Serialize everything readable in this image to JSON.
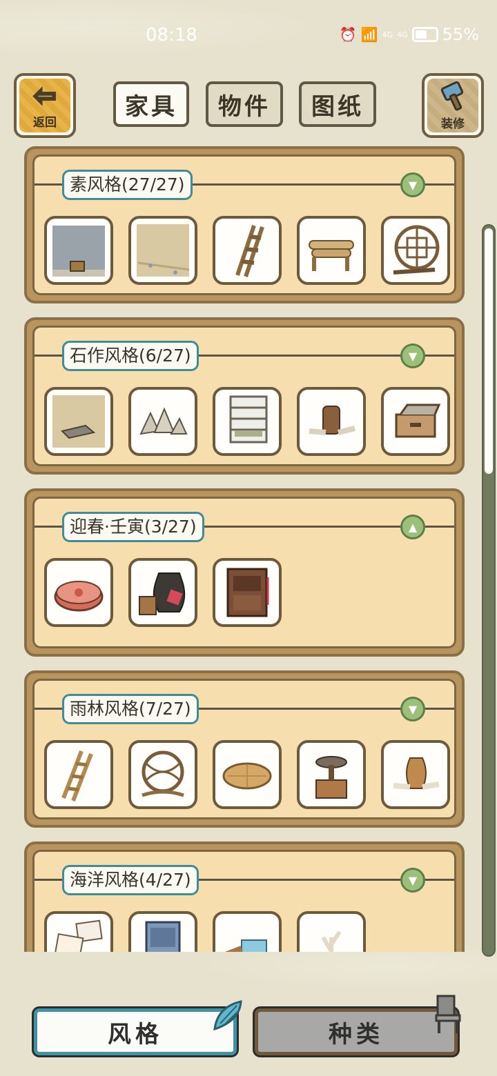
{
  "status_bar": {
    "time": "08:18",
    "battery": "55%",
    "signal_1": "4G",
    "signal_2": "4G"
  },
  "top_bar": {
    "back_label": "返回",
    "decor_label": "装修",
    "tabs": [
      {
        "label": "家具",
        "active": true
      },
      {
        "label": "物件",
        "active": false
      },
      {
        "label": "图纸",
        "active": false
      }
    ]
  },
  "sections": [
    {
      "title": "素风格(27/27)",
      "expanded": false,
      "items": [
        "wall-panel-with-bucket",
        "sand-floor",
        "wooden-ladder",
        "log-bench",
        "round-lattice-window"
      ]
    },
    {
      "title": "石作风格(6/27)",
      "expanded": false,
      "items": [
        "stone-floor",
        "rock-pile",
        "stone-shelf",
        "stump-table",
        "stone-chest"
      ]
    },
    {
      "title": "迎春·壬寅(3/27)",
      "expanded": true,
      "items": [
        "red-flower-cushion",
        "pickle-jar-with-bucket",
        "red-wood-cabinet"
      ]
    },
    {
      "title": "雨林风格(7/27)",
      "expanded": false,
      "items": [
        "bamboo-ladder",
        "rattan-sphere",
        "woven-round-mat",
        "tea-grinder-table",
        "clay-vase-on-logs"
      ]
    },
    {
      "title": "海洋风格(4/27)",
      "expanded": false,
      "items": [
        "shell-notes",
        "blue-cabinet",
        "water-fountain",
        "coral-branch"
      ]
    }
  ],
  "bottom_nav": {
    "style_label": "风格",
    "kind_label": "种类"
  },
  "colors": {
    "accent_teal": "#3e93a6",
    "panel": "#f6deae",
    "frame": "#b8955f",
    "toggle": "#9cc07a"
  }
}
